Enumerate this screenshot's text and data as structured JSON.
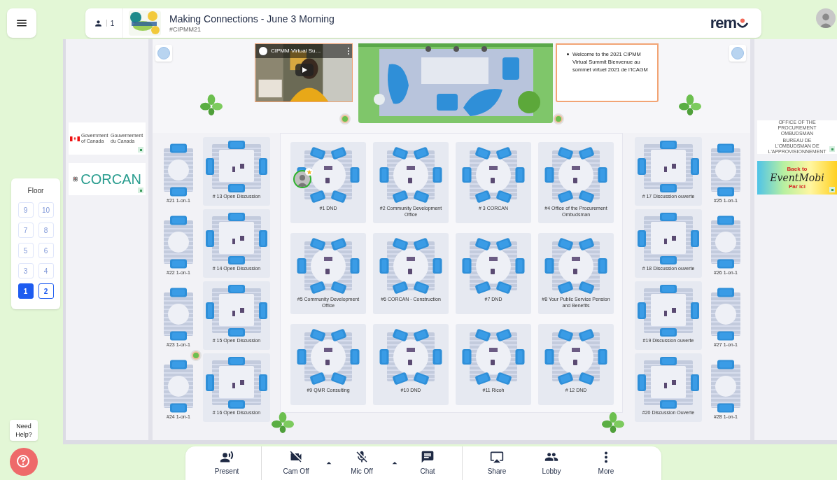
{
  "header": {
    "attendees": "1",
    "title": "Making Connections - June 3 Morning",
    "subtitle": "#CIPMM21",
    "brand": "rem"
  },
  "video": {
    "title": "CIPMM Virtual Su…"
  },
  "welcome_note": [
    "Welcome to the 2021 CIPMM Virtual Summit Bienvenue au sommet virtuel 2021 de l'ICAGM"
  ],
  "sponsors_left": [
    {
      "kind": "government",
      "texts": [
        "Government of Canada",
        "Gouvernement du Canada"
      ]
    },
    {
      "kind": "corcan",
      "texts": [
        "CORCAN"
      ]
    }
  ],
  "sponsors_right": [
    {
      "kind": "ombudsman",
      "texts": [
        "OFFICE OF THE PROCUREMENT OMBUDSMAN",
        "BUREAU DE L'OMBUDSMAN DE L'APPROVISIONNEMENT"
      ]
    },
    {
      "kind": "eventmobi",
      "texts": [
        "Back to",
        "EventMobi",
        "Par ici"
      ]
    }
  ],
  "tables": {
    "left_pairs": [
      {
        "label": "#21 1-on-1",
        "kind": "pair"
      },
      {
        "label": "#22 1-on-1",
        "kind": "pair"
      },
      {
        "label": "#23 1-on-1",
        "kind": "pair"
      },
      {
        "label": "#24 1-on-1",
        "kind": "pair"
      }
    ],
    "left_open": [
      {
        "label": "# 13 Open Discussion",
        "kind": "square"
      },
      {
        "label": "# 14 Open Discussion",
        "kind": "square"
      },
      {
        "label": "# 15 Open Discussion",
        "kind": "square"
      },
      {
        "label": "# 16 Open Discussion",
        "kind": "square"
      }
    ],
    "hall": [
      {
        "label": "#1 DND",
        "kind": "round",
        "occupied": true
      },
      {
        "label": "#2 Community Development Office",
        "kind": "round",
        "occupied": false
      },
      {
        "label": "# 3 CORCAN",
        "kind": "round",
        "occupied": false
      },
      {
        "label": "#4 Office of the Procurement Ombudsman",
        "kind": "round",
        "occupied": false
      },
      {
        "label": "#5 Community Development Office",
        "kind": "round",
        "occupied": false
      },
      {
        "label": "#6 CORCAN - Construction",
        "kind": "round",
        "occupied": false
      },
      {
        "label": "#7 DND",
        "kind": "round",
        "occupied": false
      },
      {
        "label": "#8 Your Public Service Pension and Benefits",
        "kind": "round",
        "occupied": false
      },
      {
        "label": "#9 QMR Consulting",
        "kind": "round",
        "occupied": false
      },
      {
        "label": "#10 DND",
        "kind": "round",
        "occupied": false
      },
      {
        "label": "#11 Ricoh",
        "kind": "round",
        "occupied": false
      },
      {
        "label": "# 12 DND",
        "kind": "round",
        "occupied": false
      }
    ],
    "right_open": [
      {
        "label": "# 17 Discussion ouverte",
        "kind": "square"
      },
      {
        "label": "# 18 Discussion ouverte",
        "kind": "square"
      },
      {
        "label": "#19 Discussion ouverte",
        "kind": "square"
      },
      {
        "label": "#20 Discussion Ouverte",
        "kind": "square"
      }
    ],
    "right_pairs": [
      {
        "label": "#25 1-on-1",
        "kind": "pair"
      },
      {
        "label": "#26 1-on-1",
        "kind": "pair"
      },
      {
        "label": "#27 1-on-1",
        "kind": "pair"
      },
      {
        "label": "#28 1-on-1",
        "kind": "pair"
      }
    ]
  },
  "floor_panel": {
    "title": "Floor"
  },
  "floors": [
    {
      "label": "9",
      "selected": false,
      "disabled": true
    },
    {
      "label": "10",
      "selected": false,
      "disabled": true
    },
    {
      "label": "7",
      "selected": false,
      "disabled": true
    },
    {
      "label": "8",
      "selected": false,
      "disabled": true
    },
    {
      "label": "5",
      "selected": false,
      "disabled": true
    },
    {
      "label": "6",
      "selected": false,
      "disabled": true
    },
    {
      "label": "3",
      "selected": false,
      "disabled": true
    },
    {
      "label": "4",
      "selected": false,
      "disabled": true
    },
    {
      "label": "1",
      "selected": true,
      "disabled": false
    },
    {
      "label": "2",
      "selected": false,
      "disabled": false
    }
  ],
  "help": {
    "text": "Need Help?"
  },
  "toolbar": [
    [
      {
        "label": "Present",
        "kind": "present",
        "caret": false
      }
    ],
    [
      {
        "label": "Cam Off",
        "kind": "camera",
        "caret": true
      },
      {
        "label": "Mic Off",
        "kind": "mic",
        "caret": true
      },
      {
        "label": "Chat",
        "kind": "chat",
        "caret": false
      }
    ],
    [
      {
        "label": "Share",
        "kind": "share",
        "caret": false
      },
      {
        "label": "Lobby",
        "kind": "lobby",
        "caret": false
      },
      {
        "label": "More",
        "kind": "more",
        "caret": false
      }
    ]
  ]
}
